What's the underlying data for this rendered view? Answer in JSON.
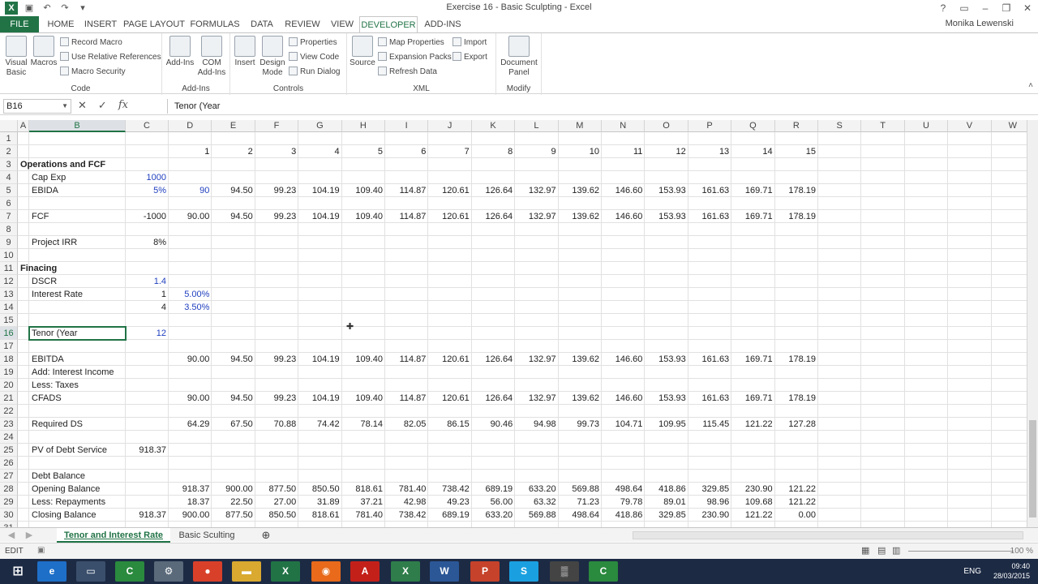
{
  "window": {
    "title": "Exercise 16 - Basic Sculpting - Excel",
    "user": "Monika Lewenski"
  },
  "ribbon_tabs": [
    "FILE",
    "HOME",
    "INSERT",
    "PAGE LAYOUT",
    "FORMULAS",
    "DATA",
    "REVIEW",
    "VIEW",
    "DEVELOPER",
    "ADD-INS"
  ],
  "active_tab": "DEVELOPER",
  "ribbon": {
    "code": {
      "label": "Code",
      "visual_basic": "Visual Basic",
      "macros": "Macros",
      "record_macro": "Record Macro",
      "relative_refs": "Use Relative References",
      "macro_security": "Macro Security"
    },
    "addins": {
      "label": "Add-Ins",
      "addins": "Add-Ins",
      "com_addins": "COM Add-Ins"
    },
    "controls": {
      "label": "Controls",
      "insert": "Insert",
      "design_mode": "Design Mode",
      "properties": "Properties",
      "view_code": "View Code",
      "run_dialog": "Run Dialog"
    },
    "xml": {
      "label": "XML",
      "source": "Source",
      "map_properties": "Map Properties",
      "expansion_packs": "Expansion Packs",
      "refresh_data": "Refresh Data",
      "import": "Import",
      "export": "Export"
    },
    "modify": {
      "label": "Modify",
      "document_panel": "Document Panel"
    }
  },
  "formula_bar": {
    "name_box": "B16",
    "formula": "Tenor (Year"
  },
  "columns": [
    "A",
    "B",
    "C",
    "D",
    "E",
    "F",
    "G",
    "H",
    "I",
    "J",
    "K",
    "L",
    "M",
    "N",
    "O",
    "P",
    "Q",
    "R",
    "S",
    "T",
    "U",
    "V",
    "W"
  ],
  "rows": {
    "2": {
      "D": "1",
      "E": "2",
      "F": "3",
      "G": "4",
      "H": "5",
      "I": "6",
      "J": "7",
      "K": "8",
      "L": "9",
      "M": "10",
      "N": "11",
      "O": "12",
      "P": "13",
      "Q": "14",
      "R": "15"
    },
    "3": {
      "A": "Operations and FCF"
    },
    "4": {
      "B": "Cap Exp",
      "C": "1000"
    },
    "5": {
      "B": "EBIDA",
      "C": "5%",
      "D": "90",
      "E": "94.50",
      "F": "99.23",
      "G": "104.19",
      "H": "109.40",
      "I": "114.87",
      "J": "120.61",
      "K": "126.64",
      "L": "132.97",
      "M": "139.62",
      "N": "146.60",
      "O": "153.93",
      "P": "161.63",
      "Q": "169.71",
      "R": "178.19"
    },
    "7": {
      "B": "FCF",
      "C": "-1000",
      "D": "90.00",
      "E": "94.50",
      "F": "99.23",
      "G": "104.19",
      "H": "109.40",
      "I": "114.87",
      "J": "120.61",
      "K": "126.64",
      "L": "132.97",
      "M": "139.62",
      "N": "146.60",
      "O": "153.93",
      "P": "161.63",
      "Q": "169.71",
      "R": "178.19"
    },
    "9": {
      "B": "Project IRR",
      "C": "8%"
    },
    "11": {
      "A": "Finacing"
    },
    "12": {
      "B": "DSCR",
      "C": "1.4"
    },
    "13": {
      "B": "Interest Rate",
      "C": "1",
      "D": "5.00%"
    },
    "14": {
      "C": "4",
      "D": "3.50%"
    },
    "16": {
      "B": "Tenor (Year",
      "C": "12"
    },
    "18": {
      "B": "EBITDA",
      "D": "90.00",
      "E": "94.50",
      "F": "99.23",
      "G": "104.19",
      "H": "109.40",
      "I": "114.87",
      "J": "120.61",
      "K": "126.64",
      "L": "132.97",
      "M": "139.62",
      "N": "146.60",
      "O": "153.93",
      "P": "161.63",
      "Q": "169.71",
      "R": "178.19"
    },
    "19": {
      "B": "Add: Interest Income"
    },
    "20": {
      "B": "Less: Taxes"
    },
    "21": {
      "B": "CFADS",
      "D": "90.00",
      "E": "94.50",
      "F": "99.23",
      "G": "104.19",
      "H": "109.40",
      "I": "114.87",
      "J": "120.61",
      "K": "126.64",
      "L": "132.97",
      "M": "139.62",
      "N": "146.60",
      "O": "153.93",
      "P": "161.63",
      "Q": "169.71",
      "R": "178.19"
    },
    "23": {
      "B": "Required DS",
      "D": "64.29",
      "E": "67.50",
      "F": "70.88",
      "G": "74.42",
      "H": "78.14",
      "I": "82.05",
      "J": "86.15",
      "K": "90.46",
      "L": "94.98",
      "M": "99.73",
      "N": "104.71",
      "O": "109.95",
      "P": "115.45",
      "Q": "121.22",
      "R": "127.28"
    },
    "25": {
      "B": "PV of Debt Service",
      "C": "918.37"
    },
    "27": {
      "B": "Debt Balance"
    },
    "28": {
      "B": "Opening Balance",
      "D": "918.37",
      "E": "900.00",
      "F": "877.50",
      "G": "850.50",
      "H": "818.61",
      "I": "781.40",
      "J": "738.42",
      "K": "689.19",
      "L": "633.20",
      "M": "569.88",
      "N": "498.64",
      "O": "418.86",
      "P": "329.85",
      "Q": "230.90",
      "R": "121.22"
    },
    "29": {
      "B": "Less: Repayments",
      "D": "18.37",
      "E": "22.50",
      "F": "27.00",
      "G": "31.89",
      "H": "37.21",
      "I": "42.98",
      "J": "49.23",
      "K": "56.00",
      "L": "63.32",
      "M": "71.23",
      "N": "79.78",
      "O": "89.01",
      "P": "98.96",
      "Q": "109.68",
      "R": "121.22"
    },
    "30": {
      "B": "Closing Balance",
      "C": "918.37",
      "D": "900.00",
      "E": "877.50",
      "F": "850.50",
      "G": "818.61",
      "H": "781.40",
      "I": "738.42",
      "J": "689.19",
      "K": "633.20",
      "L": "569.88",
      "M": "498.64",
      "N": "418.86",
      "O": "329.85",
      "P": "230.90",
      "Q": "121.22",
      "R": "0.00"
    }
  },
  "blue_cells": [
    "C4",
    "C5",
    "D5",
    "C12",
    "D13",
    "D14",
    "C16"
  ],
  "bold_cells": [
    "A3",
    "A11"
  ],
  "sheet_tabs": [
    "Tenor and Interest Rate",
    "Basic Sculting"
  ],
  "active_sheet": "Tenor and Interest Rate",
  "status": {
    "mode": "EDIT",
    "zoom": "100 %"
  },
  "taskbar": {
    "language": "ENG",
    "time": "09:40",
    "date": "28/03/2015"
  },
  "colors": {
    "excel_green": "#217346",
    "input_blue": "#1f3fbf",
    "taskbar": "#1c2a44"
  }
}
